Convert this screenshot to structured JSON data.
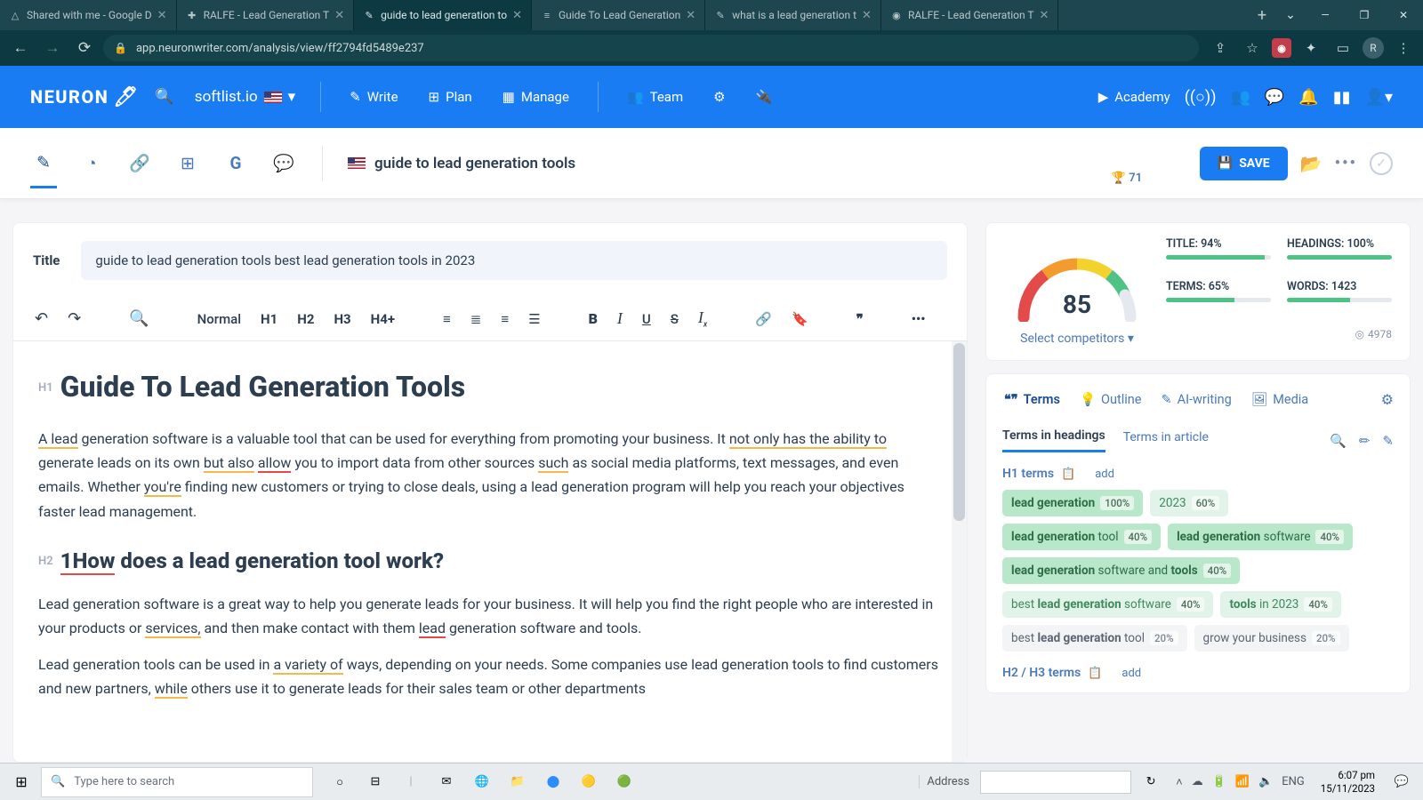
{
  "browser": {
    "tabs": [
      {
        "favicon": "△",
        "text": "Shared with me - Google D"
      },
      {
        "favicon": "✚",
        "text": "RALFE - Lead Generation T"
      },
      {
        "favicon": "✎",
        "text": "guide to lead generation to",
        "active": true
      },
      {
        "favicon": "≡",
        "text": "Guide To Lead Generation"
      },
      {
        "favicon": "✎",
        "text": "what is a lead generation t"
      },
      {
        "favicon": "◉",
        "text": "RALFE - Lead Generation T"
      }
    ],
    "url": "app.neuronwriter.com/analysis/view/ff2794fd5489e237",
    "avatar": "R"
  },
  "app": {
    "logo": "NEURON",
    "workspace": "softlist.io",
    "nav": {
      "write": "Write",
      "plan": "Plan",
      "manage": "Manage",
      "team": "Team"
    },
    "academy": "Academy"
  },
  "toolbar": {
    "keyword": "guide to lead generation tools",
    "save": "SAVE"
  },
  "editor": {
    "title_label": "Title",
    "title": "guide to lead generation tools best lead generation tools in 2023",
    "format_style": "Normal",
    "h1": "Guide To Lead Generation Tools",
    "p1a": "A lead",
    "p1b": " generation software is a valuable tool that can be used for everything from promoting your business. It ",
    "p1c": "not only has the ability to",
    "p1d": " generate leads on its own ",
    "p1e": "but also",
    "p1f": " ",
    "p1g": "allow",
    "p1h": " you to import data from other sources ",
    "p1i": "such",
    "p1j": " as social media platforms, text messages, and even emails. Whether ",
    "p1k": "you're",
    "p1l": " finding new customers or trying to close deals, using a lead generation program will help you reach your objectives faster lead management.",
    "h2a": "1How",
    "h2b": " does a lead generation tool work?",
    "p2a": "Lead generation software is a great way to help you generate leads for your business. It will help you find the right people who are interested in your products or ",
    "p2b": "services,",
    "p2c": " and then make contact with them ",
    "p2d": "lead",
    "p2e": " generation software and tools.",
    "p3a": "Lead generation tools can be used in ",
    "p3b": "a variety of",
    "p3c": " ways, depending on your needs. Some companies use lead generation tools to find customers and new partners, ",
    "p3d": "while",
    "p3e": " others use it to generate leads for their sales team or other departments"
  },
  "gauge": {
    "score": "85",
    "trophy": "🏆 71",
    "select": "Select competitors ▾",
    "avg": "4978",
    "metrics": {
      "title": {
        "label": "TITLE: 94%",
        "pct": 94
      },
      "headings": {
        "label": "HEADINGS: 100%",
        "pct": 100
      },
      "terms": {
        "label": "TERMS: 65%",
        "pct": 65
      },
      "words": {
        "label": "WORDS: 1423",
        "pct": 60
      }
    }
  },
  "panel": {
    "tabs": {
      "terms": "Terms",
      "outline": "Outline",
      "ai": "AI-writing",
      "media": "Media"
    },
    "sub": {
      "headings": "Terms in headings",
      "article": "Terms in article"
    },
    "h1group": {
      "title": "H1 terms",
      "add": "add"
    },
    "h2group": {
      "title": "H2 / H3 terms",
      "add": "add"
    },
    "chips": [
      {
        "cls": "g",
        "html": "<b>lead generation</b>",
        "pct": "100%"
      },
      {
        "cls": "l",
        "html": "2023",
        "pct": "60%"
      },
      {
        "cls": "g",
        "html": "<b>lead generation</b> tool",
        "pct": "40%"
      },
      {
        "cls": "g",
        "html": "<b>lead generation</b> software",
        "pct": "40%"
      },
      {
        "cls": "g",
        "html": "<b>lead generation</b> software and <b>tools</b>",
        "pct": "40%"
      },
      {
        "cls": "l",
        "html": "best <b>lead generation</b> software",
        "pct": "40%"
      },
      {
        "cls": "l",
        "html": "<b>tools</b> in 2023",
        "pct": "40%"
      },
      {
        "cls": "w",
        "html": "best <b>lead generation</b> tool",
        "pct": "20%"
      },
      {
        "cls": "w",
        "html": "grow your business",
        "pct": "20%"
      }
    ]
  },
  "taskbar": {
    "search": "Type here to search",
    "addr": "Address",
    "lang": "ENG",
    "time": "6:07 pm",
    "date": "15/11/2023"
  }
}
